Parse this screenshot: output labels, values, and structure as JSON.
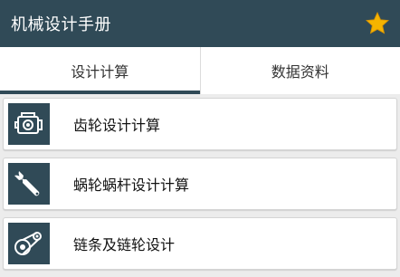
{
  "header": {
    "title": "机械设计手册",
    "favorite_icon": "star-icon",
    "accent": "#f5b400",
    "bar_color": "#304a57"
  },
  "tabs": [
    {
      "label": "设计计算",
      "active": true
    },
    {
      "label": "数据资料",
      "active": false
    }
  ],
  "list": {
    "items": [
      {
        "label": "齿轮设计计算",
        "icon": "gear-engine-icon"
      },
      {
        "label": "蜗轮蜗杆设计计算",
        "icon": "wrench-icon"
      },
      {
        "label": "链条及链轮设计",
        "icon": "chain-sprocket-icon"
      }
    ]
  }
}
